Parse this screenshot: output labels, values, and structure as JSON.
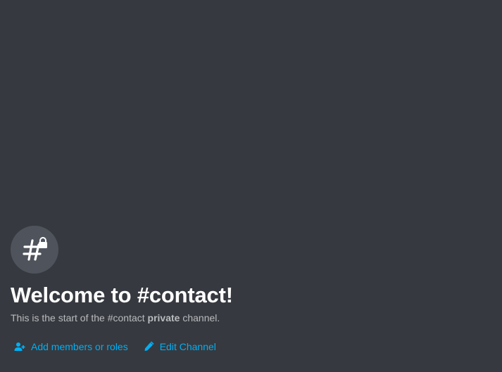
{
  "welcome": {
    "badge_icon": "hashtag-lock-icon",
    "title": "Welcome to #contact!",
    "subtitle_prefix": "This is the start of the #contact ",
    "subtitle_bold": "private",
    "subtitle_suffix": " channel."
  },
  "actions": {
    "add_members": {
      "icon": "add-user-icon",
      "label": "Add members or roles"
    },
    "edit_channel": {
      "icon": "pencil-icon",
      "label": "Edit Channel"
    }
  },
  "colors": {
    "background": "#36393f",
    "badge": "#4f545c",
    "link": "#00b0f4",
    "muted_text": "#b9bbbe",
    "title_text": "#ffffff"
  }
}
